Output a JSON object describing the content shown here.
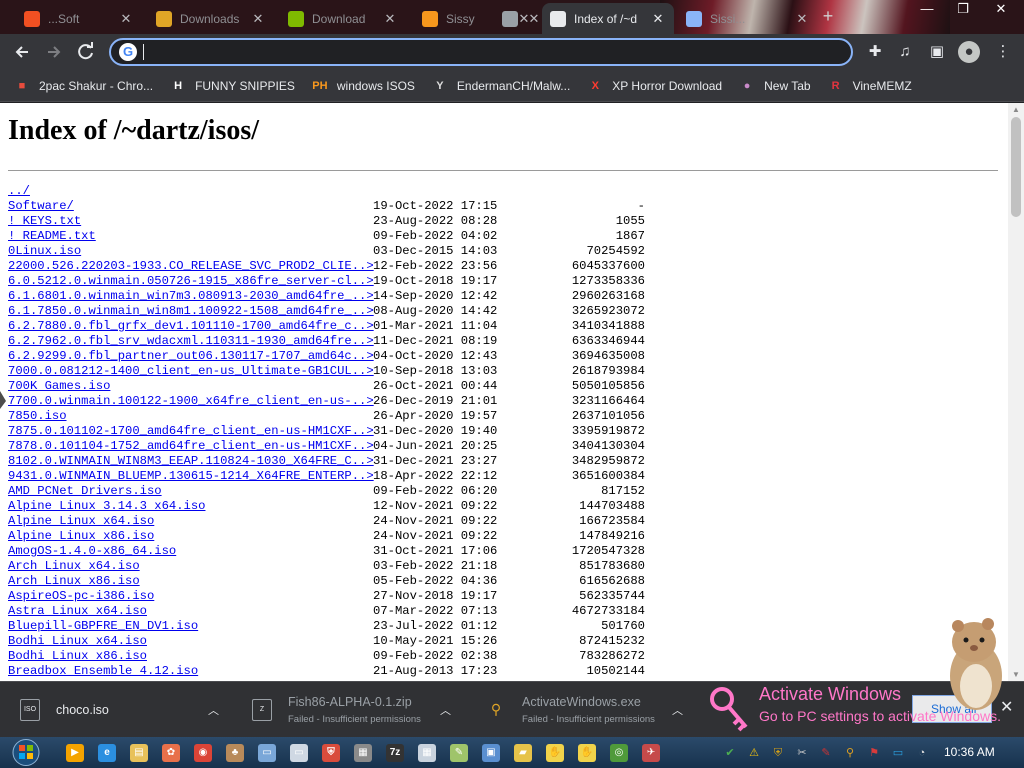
{
  "tabs": [
    {
      "label": "...Soft",
      "favicon": "ms-icon",
      "color": "#f25022"
    },
    {
      "label": "Downloads",
      "favicon": "hand-icon",
      "color": "#e0a526"
    },
    {
      "label": "Download",
      "favicon": "ms-icon",
      "color": "#7fba00"
    },
    {
      "label": "Sissy",
      "favicon": "ph-icon",
      "color": "#f7971d"
    },
    {
      "label": "",
      "favicon": "audio-icon",
      "color": "#9aa0a6"
    },
    {
      "label": "Index of /~d",
      "favicon": "globe-icon",
      "color": "#e8eaed"
    },
    {
      "label": "Sissi...",
      "favicon": "chrome-icon",
      "color": "#8ab4f8"
    }
  ],
  "window_controls": {
    "minimize": "—",
    "maximize": "❐",
    "close": "✕"
  },
  "omnibox": {
    "value": ""
  },
  "bookmarks": [
    {
      "label": "2pac Shakur - Chro...",
      "icon": "bag-icon",
      "color": "#e84c3d",
      "glyph": "■"
    },
    {
      "label": "FUNNY SNIPPIES",
      "icon": "h-icon",
      "color": "#ffffff",
      "glyph": "H"
    },
    {
      "label": "windows ISOS",
      "icon": "ph-icon",
      "color": "#f7971d",
      "glyph": "PH"
    },
    {
      "label": "EndermanCH/Malw...",
      "icon": "yp-icon",
      "color": "#dddddd",
      "glyph": "Y"
    },
    {
      "label": "XP Horror Download",
      "icon": "x-icon",
      "color": "#ff3b30",
      "glyph": "X"
    },
    {
      "label": "New Tab",
      "icon": "newtab-icon",
      "color": "#c98ac9",
      "glyph": "●"
    },
    {
      "label": "VineMEMZ",
      "icon": "vine-icon",
      "color": "#e2343f",
      "glyph": "R"
    }
  ],
  "page": {
    "title": "Index of /~dartz/isos/",
    "files": [
      {
        "name": "../",
        "date": "",
        "size": ""
      },
      {
        "name": "Software/",
        "date": "19-Oct-2022 17:15",
        "size": "-"
      },
      {
        "name": "! KEYS.txt",
        "date": "23-Aug-2022 08:28",
        "size": "1055"
      },
      {
        "name": "! README.txt",
        "date": "09-Feb-2022 04:02",
        "size": "1867"
      },
      {
        "name": "0Linux.iso",
        "date": "03-Dec-2015 14:03",
        "size": "70254592"
      },
      {
        "name": "22000.526.220203-1933.CO_RELEASE_SVC_PROD2_CLIE..>",
        "date": "12-Feb-2022 23:56",
        "size": "6045337600"
      },
      {
        "name": "6.0.5212.0.winmain.050726-1915_x86fre_server-cl..>",
        "date": "19-Oct-2018 19:17",
        "size": "1273358336"
      },
      {
        "name": "6.1.6801.0.winmain_win7m3.080913-2030_amd64fre_..>",
        "date": "14-Sep-2020 12:42",
        "size": "2960263168"
      },
      {
        "name": "6.1.7850.0.winmain_win8m1.100922-1508_amd64fre_..>",
        "date": "08-Aug-2020 14:42",
        "size": "3265923072"
      },
      {
        "name": "6.2.7880.0.fbl_grfx_dev1.101110-1700_amd64fre_c..>",
        "date": "01-Mar-2021 11:04",
        "size": "3410341888"
      },
      {
        "name": "6.2.7962.0.fbl_srv_wdacxml.110311-1930_amd64fre..>",
        "date": "11-Dec-2021 08:19",
        "size": "6363346944"
      },
      {
        "name": "6.2.9299.0.fbl_partner_out06.130117-1707_amd64c..>",
        "date": "04-Oct-2020 12:43",
        "size": "3694635008"
      },
      {
        "name": "7000.0.081212-1400_client_en-us_Ultimate-GB1CUL..>",
        "date": "10-Sep-2018 13:03",
        "size": "2618793984"
      },
      {
        "name": "700K Games.iso",
        "date": "26-Oct-2021 00:44",
        "size": "5050105856"
      },
      {
        "name": "7700.0.winmain.100122-1900_x64fre_client_en-us-..>",
        "date": "26-Dec-2019 21:01",
        "size": "3231166464"
      },
      {
        "name": "7850.iso",
        "date": "26-Apr-2020 19:57",
        "size": "2637101056"
      },
      {
        "name": "7875.0.101102-1700_amd64fre_client_en-us-HM1CXF..>",
        "date": "31-Dec-2020 19:40",
        "size": "3395919872"
      },
      {
        "name": "7878.0.101104-1752_amd64fre_client_en-us-HM1CXF..>",
        "date": "04-Jun-2021 20:25",
        "size": "3404130304"
      },
      {
        "name": "8102.0.WINMAIN_WIN8M3_EEAP.110824-1030_X64FRE_C..>",
        "date": "31-Dec-2021 23:27",
        "size": "3482959872"
      },
      {
        "name": "9431.0.WINMAIN_BLUEMP.130615-1214_X64FRE_ENTERP..>",
        "date": "18-Apr-2022 22:12",
        "size": "3651600384"
      },
      {
        "name": "AMD PCNet Drivers.iso",
        "date": "09-Feb-2022 06:20",
        "size": "817152"
      },
      {
        "name": "Alpine Linux 3.14.3 x64.iso",
        "date": "12-Nov-2021 09:22",
        "size": "144703488"
      },
      {
        "name": "Alpine Linux x64.iso",
        "date": "24-Nov-2021 09:22",
        "size": "166723584"
      },
      {
        "name": "Alpine Linux x86.iso",
        "date": "24-Nov-2021 09:22",
        "size": "147849216"
      },
      {
        "name": "AmogOS-1.4.0-x86_64.iso",
        "date": "31-Oct-2021 17:06",
        "size": "1720547328"
      },
      {
        "name": "Arch Linux x64.iso",
        "date": "03-Feb-2022 21:18",
        "size": "851783680"
      },
      {
        "name": "Arch Linux x86.iso",
        "date": "05-Feb-2022 04:36",
        "size": "616562688"
      },
      {
        "name": "AspireOS-pc-i386.iso",
        "date": "27-Nov-2018 19:17",
        "size": "562335744"
      },
      {
        "name": "Astra Linux x64.iso",
        "date": "07-Mar-2022 07:13",
        "size": "4672733184"
      },
      {
        "name": "Bluepill-GBPFRE_EN_DV1.iso",
        "date": "23-Jul-2022 01:12",
        "size": "501760"
      },
      {
        "name": "Bodhi Linux x64.iso",
        "date": "10-May-2021 15:26",
        "size": "872415232"
      },
      {
        "name": "Bodhi Linux x86.iso",
        "date": "09-Feb-2022 02:38",
        "size": "783286272"
      },
      {
        "name": "Breadbox Ensemble 4.12.iso",
        "date": "21-Aug-2013 17:23",
        "size": "10502144"
      }
    ]
  },
  "downloads": [
    {
      "name": "choco.iso",
      "status": "",
      "icon": "iso-file-icon"
    },
    {
      "name": "Fish86-ALPHA-0.1.zip",
      "status": "Failed - Insufficient permissions",
      "icon": "zip-file-icon"
    },
    {
      "name": "ActivateWindows.exe",
      "status": "Failed - Insufficient permissions",
      "icon": "pin-file-icon"
    }
  ],
  "activation": {
    "line1": "Activate Windows",
    "line2": "Go to PC settings to activate Windows.",
    "show_all": "Show all"
  },
  "taskbar": {
    "clock": "10:36 AM",
    "apps": [
      {
        "icon": "media-player-icon",
        "color": "#f4a300",
        "glyph": "▶"
      },
      {
        "icon": "ie-icon",
        "color": "#2b8fe0",
        "glyph": "e"
      },
      {
        "icon": "explorer-icon",
        "color": "#e8c15a",
        "glyph": "▤"
      },
      {
        "icon": "paint-icon",
        "color": "#e8704a",
        "glyph": "✿"
      },
      {
        "icon": "chrome-icon",
        "color": "#db4437",
        "glyph": "◉"
      },
      {
        "icon": "hamster-app-icon",
        "color": "#b88a5a",
        "glyph": "♣"
      },
      {
        "icon": "window-icon",
        "color": "#7aa7d8",
        "glyph": "▭"
      },
      {
        "icon": "notepad-window-icon",
        "color": "#cfd8e3",
        "glyph": "▭"
      },
      {
        "icon": "shield-icon",
        "color": "#d94c3c",
        "glyph": "⛨"
      },
      {
        "icon": "terminal-icon",
        "color": "#8a8a8a",
        "glyph": "▦"
      },
      {
        "icon": "7zip-icon",
        "color": "#333333",
        "glyph": "7z"
      },
      {
        "icon": "calculator-icon",
        "color": "#c9d3de",
        "glyph": "▦"
      },
      {
        "icon": "notepad-icon",
        "color": "#9fc46a",
        "glyph": "✎"
      },
      {
        "icon": "monitor-icon",
        "color": "#5a8fd0",
        "glyph": "▣"
      },
      {
        "icon": "folder-icon",
        "color": "#e6c34a",
        "glyph": "▰"
      },
      {
        "icon": "hand-icon",
        "color": "#f1d34a",
        "glyph": "✋"
      },
      {
        "icon": "hand-icon",
        "color": "#f1d34a",
        "glyph": "✋"
      },
      {
        "icon": "xbox-icon",
        "color": "#4f9a3a",
        "glyph": "◎"
      },
      {
        "icon": "toolbox-icon",
        "color": "#c64a4a",
        "glyph": "✈"
      }
    ],
    "tray": [
      {
        "icon": "check-icon",
        "color": "#4caf50",
        "glyph": "✔"
      },
      {
        "icon": "warning-icon",
        "color": "#f4c20d",
        "glyph": "⚠"
      },
      {
        "icon": "shield-tray-icon",
        "color": "#d4a017",
        "glyph": "⛨"
      },
      {
        "icon": "tools-icon",
        "color": "#cccccc",
        "glyph": "✂"
      },
      {
        "icon": "brush-icon",
        "color": "#cc3333",
        "glyph": "✎"
      },
      {
        "icon": "search-icon",
        "color": "#e0a020",
        "glyph": "⚲"
      },
      {
        "icon": "flag-icon",
        "color": "#d83b3b",
        "glyph": "⚑"
      },
      {
        "icon": "display-icon",
        "color": "#2aa0e0",
        "glyph": "▭"
      },
      {
        "icon": "volume-icon",
        "color": "#dddddd",
        "glyph": "◔"
      }
    ]
  }
}
